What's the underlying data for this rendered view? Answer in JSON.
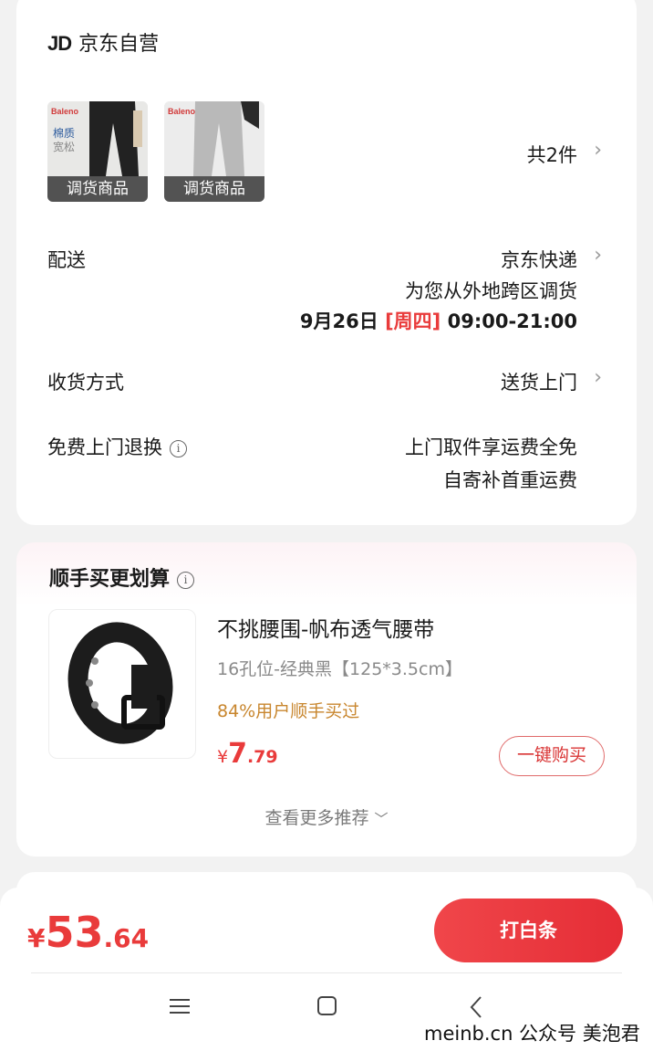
{
  "order": {
    "store_logo": "JD",
    "store_name": "京东自营",
    "products": [
      {
        "brand": "Baleno",
        "side_text": "棉质\n宽松",
        "tag": "调货商品",
        "color": "black"
      },
      {
        "brand": "Baleno",
        "side_text": "",
        "tag": "调货商品",
        "color": "grey"
      }
    ],
    "item_count": "共2件",
    "delivery": {
      "label": "配送",
      "carrier": "京东快递",
      "note": "为您从外地跨区调货",
      "date": "9月26日",
      "weekday": "[周四]",
      "time": "09:00-21:00"
    },
    "receive": {
      "label": "收货方式",
      "value": "送货上门"
    },
    "returns": {
      "label": "免费上门退换",
      "info_icon": "i",
      "line1": "上门取件享运费全免",
      "line2": "自寄补首重运费"
    }
  },
  "recommend": {
    "title": "顺手买更划算",
    "info_icon": "i",
    "product": {
      "name": "不挑腰围-帆布透气腰带",
      "spec": "16孔位-经典黑【125*3.5cm】",
      "stat": "84%用户顺手买过",
      "price_symbol": "¥",
      "price_int": "7",
      "price_dec": ".79",
      "buy_label": "一键购买"
    },
    "more_label": "查看更多推荐"
  },
  "footer": {
    "price_symbol": "¥",
    "price_int": "53",
    "price_dec": ".64",
    "pay_label": "打白条"
  },
  "watermark": "meinb.cn 公众号 美泡君",
  "colors": {
    "accent": "#e93b3b",
    "stat": "#c8862e"
  }
}
